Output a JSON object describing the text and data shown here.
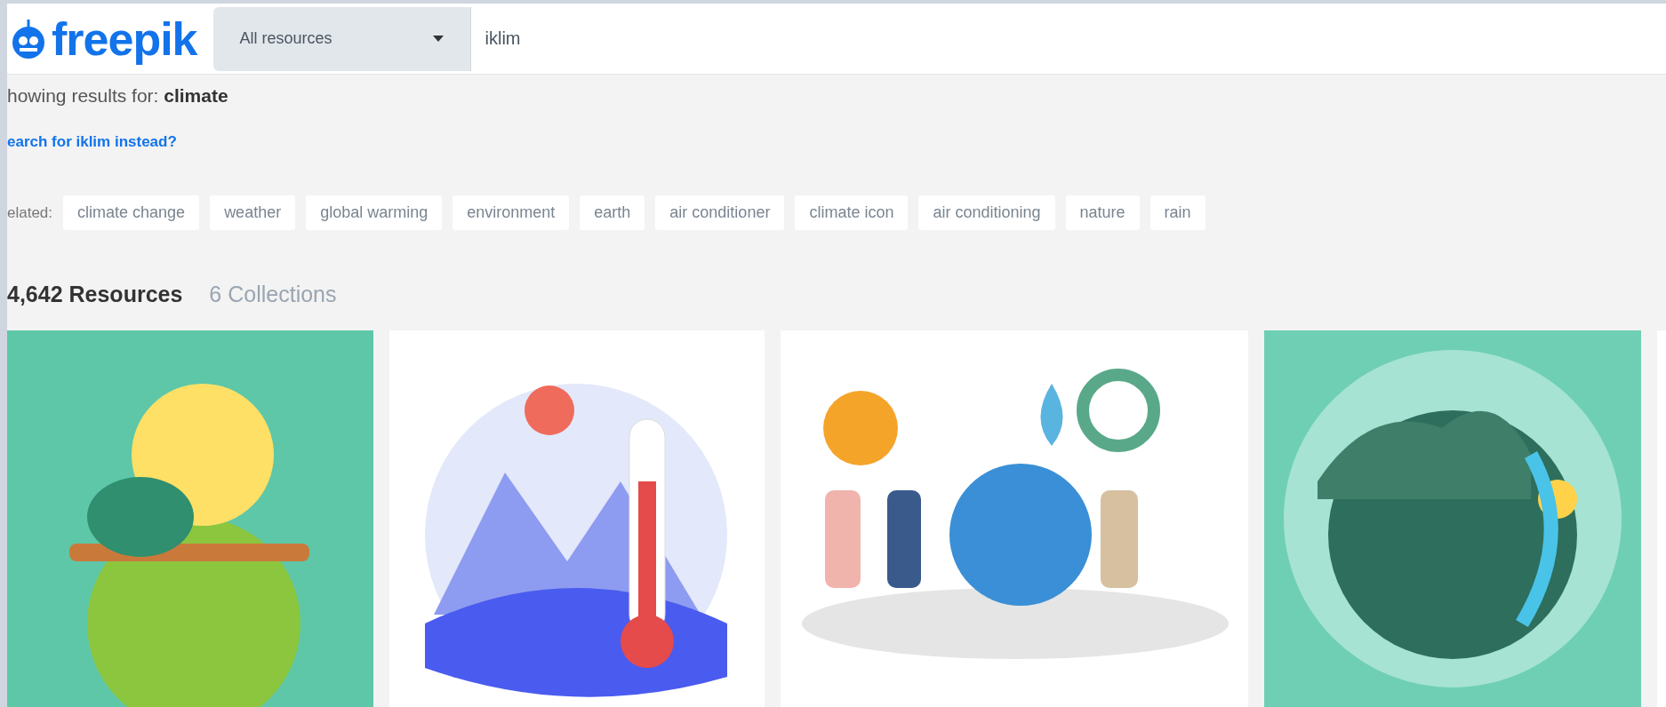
{
  "header": {
    "logo": "freepik",
    "search": {
      "category": "All resources",
      "value": "iklim"
    }
  },
  "results_notice": "howing results for: **climate**",
  "alternative_link": "earch for iklim instead?",
  "related": {
    "label": "elated:",
    "tags": [
      "climate change",
      "weather",
      "global warming",
      "environment",
      "earth",
      "air conditioner",
      "climate icon",
      "air conditioning",
      "nature",
      "rain"
    ]
  },
  "counts": {
    "resources": "4,642 Resources",
    "collections": "6 Collections"
  },
  "thumbnails": [
    {
      "kind": "planet",
      "color": "#5ec7a8"
    },
    {
      "kind": "thermometer",
      "color": "#ffffff"
    },
    {
      "kind": "people",
      "color": "#ffffff"
    },
    {
      "kind": "globe",
      "color": "#6fcfb4"
    }
  ]
}
